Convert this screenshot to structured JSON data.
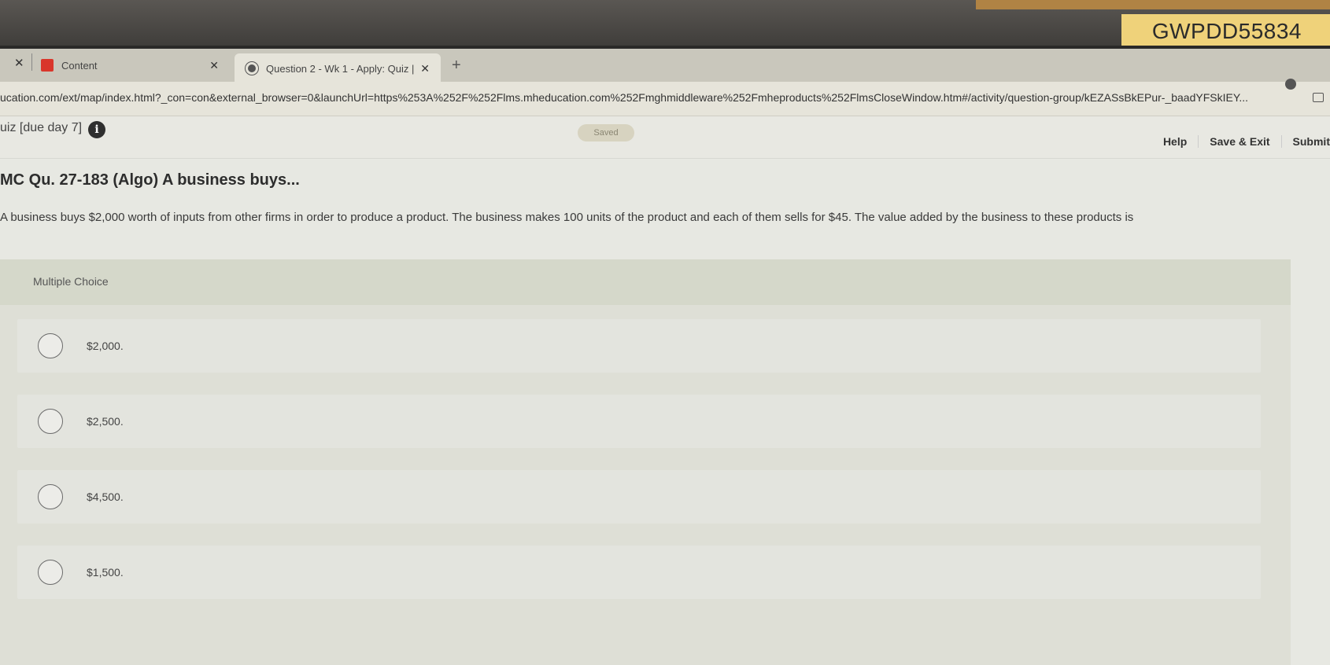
{
  "sticky_note": "GWPDD55834",
  "browser": {
    "tabs": [
      {
        "label": "Content"
      },
      {
        "label": "Question 2 - Wk 1 - Apply: Quiz |"
      }
    ],
    "url": "ucation.com/ext/map/index.html?_con=con&external_browser=0&launchUrl=https%253A%252F%252Flms.mheducation.com%252Fmghmiddleware%252Fmheproducts%252FlmsCloseWindow.htm#/activity/question-group/kEZASsBkEPur-_baadYFSkIEY..."
  },
  "header": {
    "quiz_title": "uiz [due day 7]",
    "saved": "Saved",
    "links": {
      "help": "Help",
      "save_exit": "Save & Exit",
      "submit": "Submit"
    }
  },
  "question": {
    "heading": "MC Qu. 27-183 (Algo) A business buys...",
    "text": "A business buys $2,000 worth of inputs from other firms in order to produce a product. The business makes 100 units of the product and each of them sells for $45. The value added by the business to these products is"
  },
  "choices": {
    "label": "Multiple Choice",
    "options": [
      "$2,000.",
      "$2,500.",
      "$4,500.",
      "$1,500."
    ]
  }
}
